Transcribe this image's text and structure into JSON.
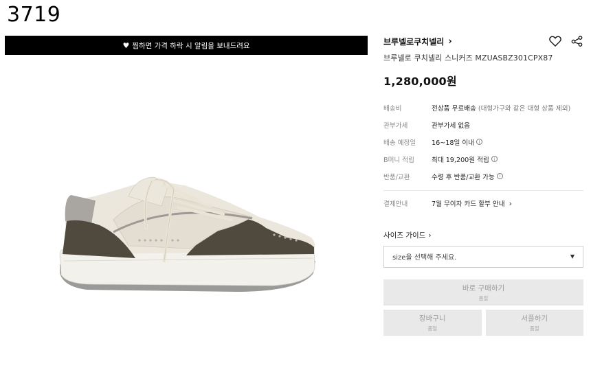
{
  "page_id": "3719",
  "banner": {
    "icon": "heart-icon",
    "text": "찜하면 가격 하락 시 알림을 보내드려요"
  },
  "product": {
    "brand": "브루넬로쿠치넬리",
    "name": "브루넬로 쿠치넬리 스니커즈 MZUASBZ301CPX87",
    "price": "1,280,000원"
  },
  "specs": [
    {
      "key": "배송비",
      "value": "전상품 무료배송",
      "note": "(대형가구와 같은 대형 상품 제외)"
    },
    {
      "key": "관부가세",
      "value": "관부가세 없음"
    },
    {
      "key": "배송 예정일",
      "value": "16~18일 이내"
    },
    {
      "key": "B머니 적립",
      "value": "최대 19,200원 적립"
    },
    {
      "key": "반품/교환",
      "value": "수령 후 반품/교환 가능"
    }
  ],
  "payment": {
    "key": "결제안내",
    "value": "7월 무이자 카드 할부 안내"
  },
  "size": {
    "guide_label": "사이즈 가이드",
    "placeholder": "size을 선택해 주세요."
  },
  "buttons": {
    "buy_label": "바로 구매하기",
    "buy_sub": "품절",
    "cart_label": "장바구니",
    "cart_sub": "품절",
    "gift_label": "서플하기",
    "gift_sub": "품절"
  },
  "colors": {
    "banner_bg": "#000000",
    "button_bg": "#e9e9e9",
    "shoe_suede": "#4f4a3d",
    "shoe_leather": "#ece7dd",
    "shoe_sole": "#f3f1ec"
  }
}
